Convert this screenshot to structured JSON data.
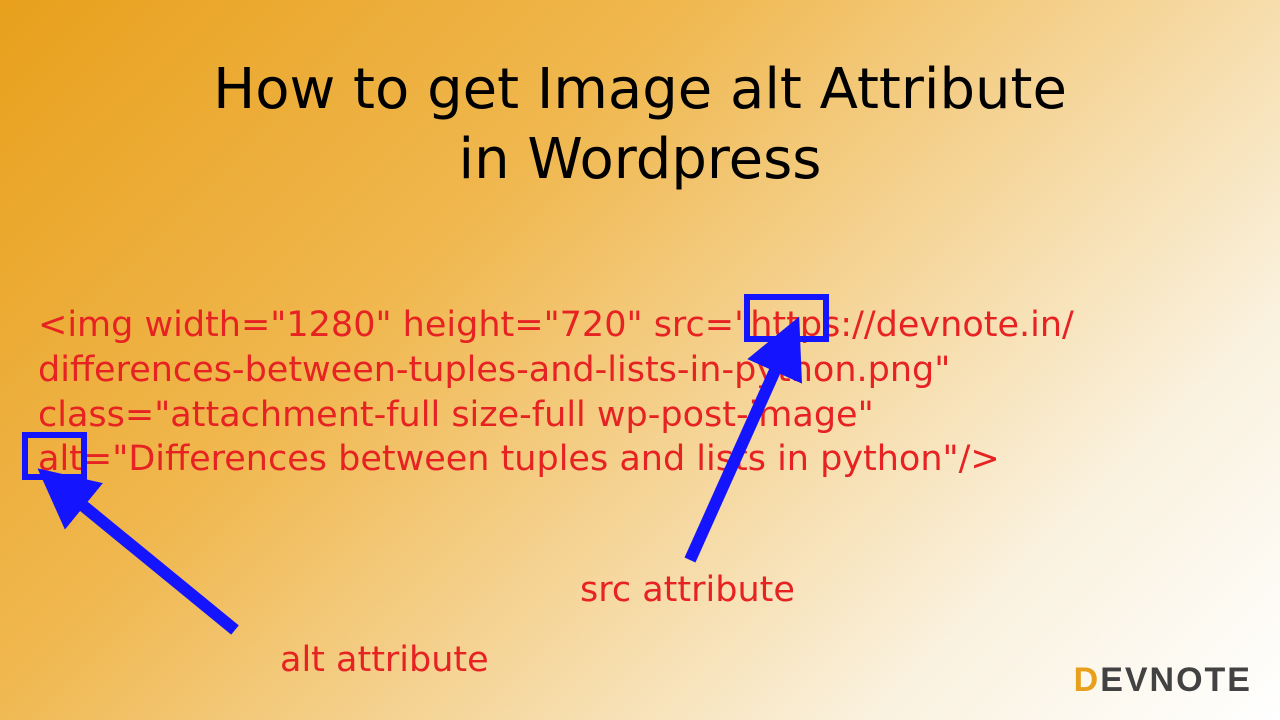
{
  "title_line1": "How to get Image alt Attribute",
  "title_line2": "in Wordpress",
  "code": "<img width=\"1280\" height=\"720\" src=\"https://devnote.in/\ndifferences-between-tuples-and-lists-in-python.png\" \nclass=\"attachment-full size-full wp-post-image\" \nalt=\"Differences between tuples and lists in python\"/>",
  "label_src": "src attribute",
  "label_alt": "alt attribute",
  "brand_d": "D",
  "brand_rest": "EVNOTE",
  "colors": {
    "accent_red": "#e62222",
    "accent_blue": "#1414ff",
    "bg_orange": "#e8a01c"
  }
}
